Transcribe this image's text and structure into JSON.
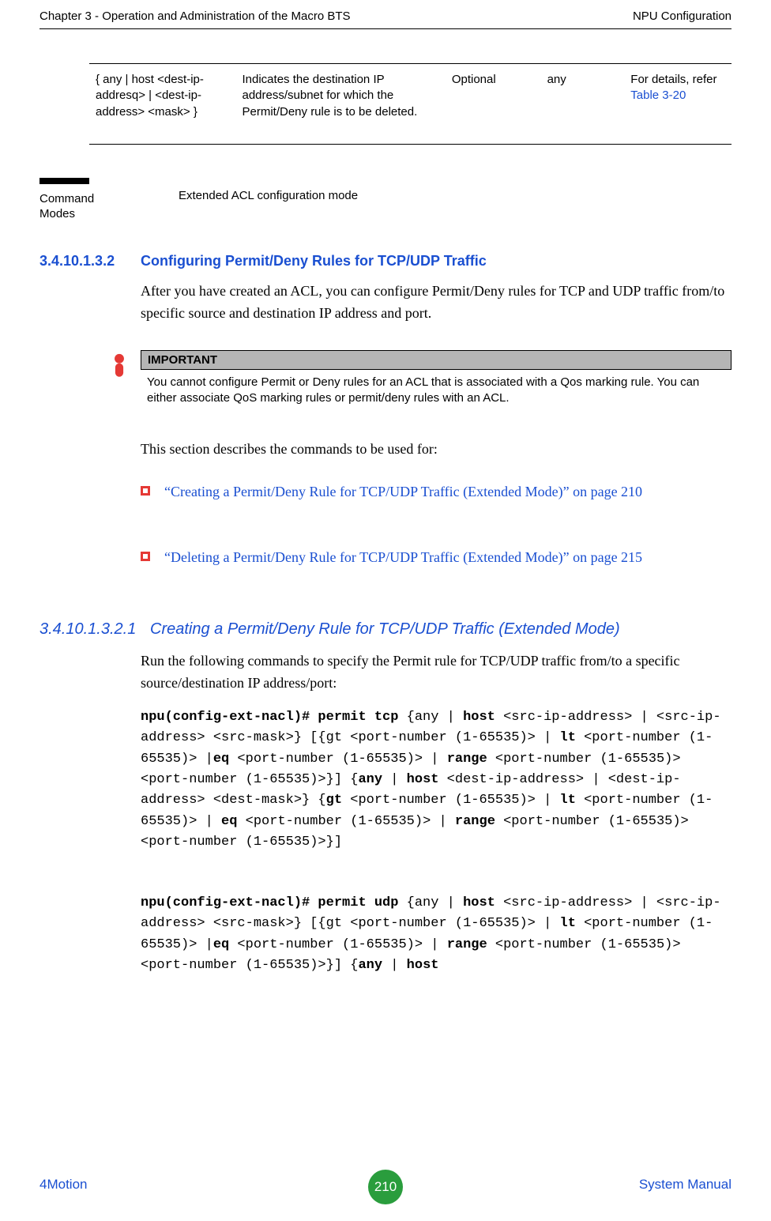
{
  "header": {
    "left": "Chapter 3 - Operation and Administration of the Macro BTS",
    "right": "NPU Configuration"
  },
  "table": {
    "row": {
      "c1": "{ any | host <dest-ip-addresq> | <dest-ip-address> <mask> }",
      "c2": "Indicates the destination IP address/subnet for which the Permit/Deny rule is to be deleted.",
      "c3": "Optional",
      "c4": "any",
      "c5a": "For details, refer ",
      "c5b": "Table 3-20"
    }
  },
  "cmdmodes": {
    "label": "Command Modes",
    "value": "Extended ACL configuration mode"
  },
  "h1": {
    "num": "3.4.10.1.3.2",
    "text": "Configuring Permit/Deny Rules for TCP/UDP Traffic"
  },
  "p1": "After you have created an ACL, you can configure Permit/Deny rules for TCP and UDP traffic from/to specific source and destination IP address and port.",
  "important": {
    "title": "IMPORTANT",
    "body": "You cannot configure Permit or Deny rules for an ACL that is associated with a Qos marking rule. You can either associate QoS marking rules or permit/deny rules with an ACL."
  },
  "p2": "This section describes the commands to be used for:",
  "bullets": {
    "b1": "“Creating a Permit/Deny Rule for TCP/UDP Traffic (Extended Mode)” on page 210",
    "b2": "“Deleting a Permit/Deny Rule for TCP/UDP Traffic (Extended Mode)” on page 215"
  },
  "h2": {
    "num": "3.4.10.1.3.2.1",
    "text": "Creating a Permit/Deny Rule for TCP/UDP Traffic (Extended Mode)"
  },
  "p3": "Run the following commands to specify the Permit rule for TCP/UDP traffic from/to a specific source/destination IP address/port:",
  "code1": {
    "prefix": "npu(config-ext-nacl)# permit tcp ",
    "t2": "{any | ",
    "host1": "host",
    "t3": " <src-ip-address> | <src-ip-address> <src-mask>} [{gt <port-number (1-65535)> | ",
    "lt1": "lt",
    "t4": " <port-number (1-65535)> |",
    "eq1": "eq",
    "t5": " <port-number (1-65535)> | ",
    "range1": "range",
    "t6": " <port-number (1-65535)> <port-number (1-65535)>}] {",
    "any1": "any",
    "t7": " | ",
    "host2": "host",
    "t8": " <dest-ip-address> | <dest-ip-address> <dest-mask>} {",
    "gt1": "gt",
    "t9": " <port-number (1-65535)>   | ",
    "lt2": "lt",
    "t10": " <port-number (1-65535)> | ",
    "eq2": "eq",
    "t11": " <port-number (1-65535)> | ",
    "range2": "range",
    "t12": " <port-number (1-65535)> <port-number (1-65535)>}]"
  },
  "code2": {
    "prefix": "npu(config-ext-nacl)# permit udp ",
    "t2": "{any | ",
    "host1": "host",
    "t3": " <src-ip-address> | <src-ip-address> <src-mask>} [{gt <port-number (1-65535)> | ",
    "lt1": "lt",
    "t4": " <port-number (1-65535)> |",
    "eq1": "eq",
    "t5": " <port-number (1-65535)> | ",
    "range1": "range",
    "t6": " <port-number (1-65535)> <port-number (1-65535)>}] {",
    "any1": "any",
    "t7": " | ",
    "host2": "host"
  },
  "footer": {
    "left": "4Motion",
    "page": "210",
    "right": "System Manual"
  }
}
